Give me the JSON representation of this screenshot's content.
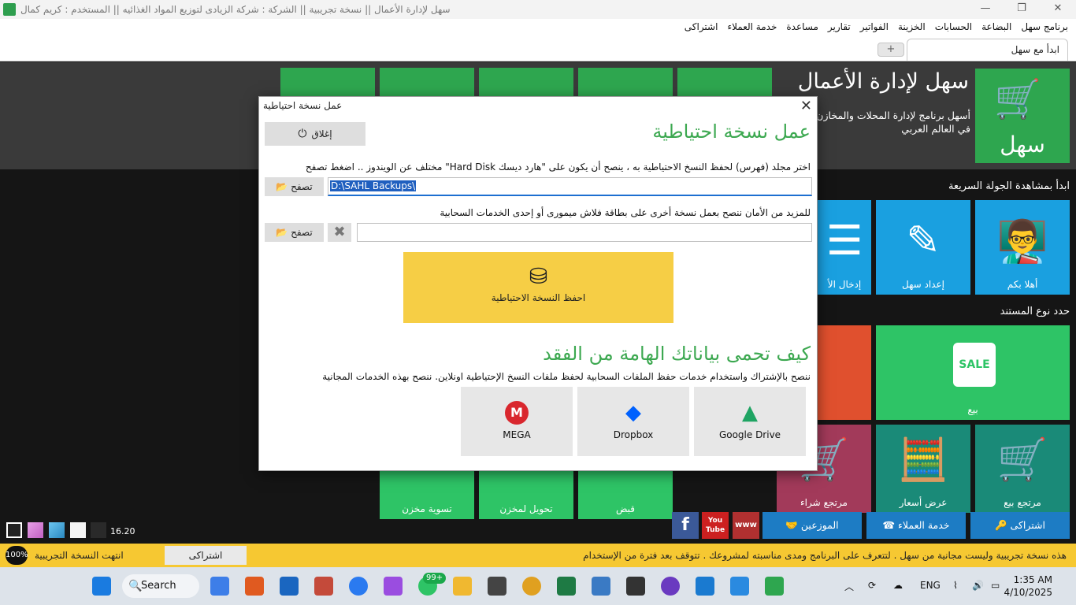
{
  "window": {
    "title": "سهل لإدارة الأعمال  ||  نسخة تجريبية  ||  الشركة : شركة الزيادى لتوزيع المواد الغذائيه  ||  المستخدم : كريم كمال",
    "minimize": "—",
    "maximize": "❐",
    "close": "✕"
  },
  "menu": [
    "برنامج سهل",
    "البضاعة",
    "الحسابات",
    "الخزينة",
    "الفواتير",
    "تقارير",
    "مساعدة",
    "خدمة العملاء",
    "اشتراكى"
  ],
  "tab": {
    "label": "ابدأ مع سهل",
    "add": "+"
  },
  "brand": {
    "title": "سهل لإدارة الأعمال",
    "subtitle": "أسهل برنامج لإدارة المحلات والمخازن في العالم العربي",
    "logo_word": "سهل"
  },
  "sections": {
    "tour": "ابدأ بمشاهدة الجولة السريعة",
    "doc_type": "حدد نوع المستند"
  },
  "tiles": {
    "welcome": "أهلا بكم",
    "setup": "إعداد سهل",
    "data_entry": "إدخال الأ",
    "sale": "بيع",
    "sale_badge": "SALE",
    "sale_return": "مرتجع بيع",
    "price_offer": "عرض أسعار",
    "purchase_return": "مرتجع شراء",
    "receipt": "قبض",
    "transfer": "تحويل لمخزن",
    "stock_adjust": "تسوية مخزن"
  },
  "bottom": {
    "subscribe": "اشتراكى",
    "customer_service": "خدمة العملاء",
    "distributors": "الموزعين",
    "youtube": "You Tube",
    "web": "www",
    "facebook": "f",
    "zoom": "16.20"
  },
  "notice": {
    "message": "هذه نسخة تجريبية وليست مجانية من سهل . لتتعرف على البرنامج ومدى مناسبته لمشروعك . تتوقف بعد فترة من الإستخدام",
    "subscribe": "اشتراكى",
    "ended": "انتهت النسخة التجريبية",
    "percent": "100%"
  },
  "dialog": {
    "title": "عمل نسخة احتياطية",
    "close_label": "إغلاق",
    "heading": "عمل نسخة احتياطية",
    "instruction": "اختر مجلد (فهرس) لحفظ النسخ الاحتياطية به ، ينصح أن يكون على \"هارد ديسك Hard Disk\" مختلف عن الويندوز .. اضغط تصفح",
    "browse": "تصفح",
    "path": "D:\\SAHL Backups\\",
    "extra_note": "للمزيد من الأمان ننصح بعمل نسخة أخرى على بطاقة فلاش ميمورى أو إحدى الخدمات السحابية",
    "browse2": "تصفح",
    "save_label": "احفظ النسخة الاحتياطية",
    "protect_heading": "كيف تحمى بياناتك الهامة من الفقد",
    "protect_text": "ننصح بالإشتراك واستخدام خدمات حفظ الملفات السحابية لحفظ ملفات النسخ الإحتياطية اونلاين. ننصح بهذه الخدمات المجانية",
    "services": [
      "MEGA",
      "Dropbox",
      "Google Drive"
    ]
  },
  "taskbar": {
    "search": "Search",
    "badge": "99+",
    "lang": "ENG",
    "time": "1:35 AM",
    "date": "4/10/2025"
  },
  "colors": {
    "green": "#2ea64f",
    "blue": "#1aa0e0",
    "teal": "#1a8a78",
    "yellow": "#f6ce45",
    "maroon": "#a23a5a"
  }
}
